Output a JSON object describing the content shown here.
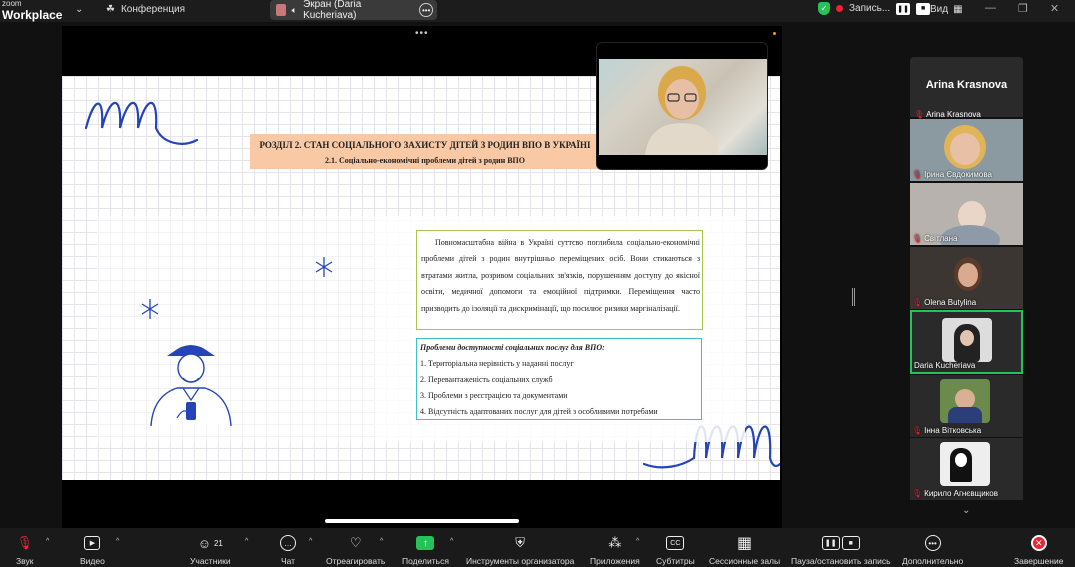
{
  "app": {
    "brand_small": "zoom",
    "brand_main": "Workplace"
  },
  "topbar": {
    "conference_label": "Конференция",
    "share_label": "Экран (Daria Kucheriava)",
    "recording_label": "Запись...",
    "view_label": "Вид"
  },
  "slide": {
    "title": "РОЗДІЛ 2. СТАН СОЦІАЛЬНОГО ЗАХИСТУ ДІТЕЙ З РОДИН ВПО В УКРАЇНІ",
    "subtitle": "2.1. Соціально-економічні проблеми дітей з родин ВПО",
    "paragraph": "Повномасштабна війна в Україні суттєво поглибила соціально-економічні проблеми дітей з родин внутрішньо переміщених осіб. Вони стикаються з втратами житла, розривом соціальних зв'язків, порушенням доступу до якісної освіти, медичної допомоги та емоційної підтримки. Переміщення часто призводить до ізоляції та дискримінації, що посилює ризики маргіналізації.",
    "list_heading": "Проблеми доступності соціальних послуг для ВПО:",
    "list_items": [
      "1. Територіальна нерівність у наданні послуг",
      "2. Перевантаженість соціальних служб",
      "3. Проблеми з реєстрацією та документами",
      "4. Відсутність адаптованих послуг для дітей з особливими потребами"
    ]
  },
  "participants": {
    "speaker_big": "Arina Krasnova",
    "list": [
      {
        "name": "Arina Krasnova",
        "muted": true
      },
      {
        "name": "Ірина Євдокимова",
        "muted": true
      },
      {
        "name": "Світлана",
        "muted": true
      },
      {
        "name": "Olena Butylina",
        "muted": true
      },
      {
        "name": "Daria Kucheriava",
        "muted": false,
        "active": true
      },
      {
        "name": "Інна Вітковська",
        "muted": true
      },
      {
        "name": "Кирило Агнєвщиков",
        "muted": true
      }
    ]
  },
  "toolbar": {
    "audio": "Звук",
    "video": "Видео",
    "participants": "Участники",
    "participants_count": "21",
    "chat": "Чат",
    "react": "Отреагировать",
    "share": "Поделиться",
    "host_tools": "Инструменты организатора",
    "apps": "Приложения",
    "captions": "Субтитры",
    "breakout": "Сессионные залы",
    "pause_rec": "Пауза/остановить запись",
    "more": "Дополнительно",
    "end": "Завершение"
  },
  "colors": {
    "accent_green": "#23c35a",
    "end_red": "#e22233",
    "title_band": "#f8c9a4",
    "box_green": "#a5c74d",
    "box_teal": "#3fc1c9",
    "deco_blue": "#2444b8"
  },
  "icons": [
    "mic-off-icon",
    "video-icon",
    "participants-icon",
    "chat-icon",
    "heart-icon",
    "share-arrow-icon",
    "shield-icon",
    "apps-icon",
    "cc-icon",
    "grid-icon",
    "pause-icon",
    "more-icon",
    "close-icon"
  ]
}
